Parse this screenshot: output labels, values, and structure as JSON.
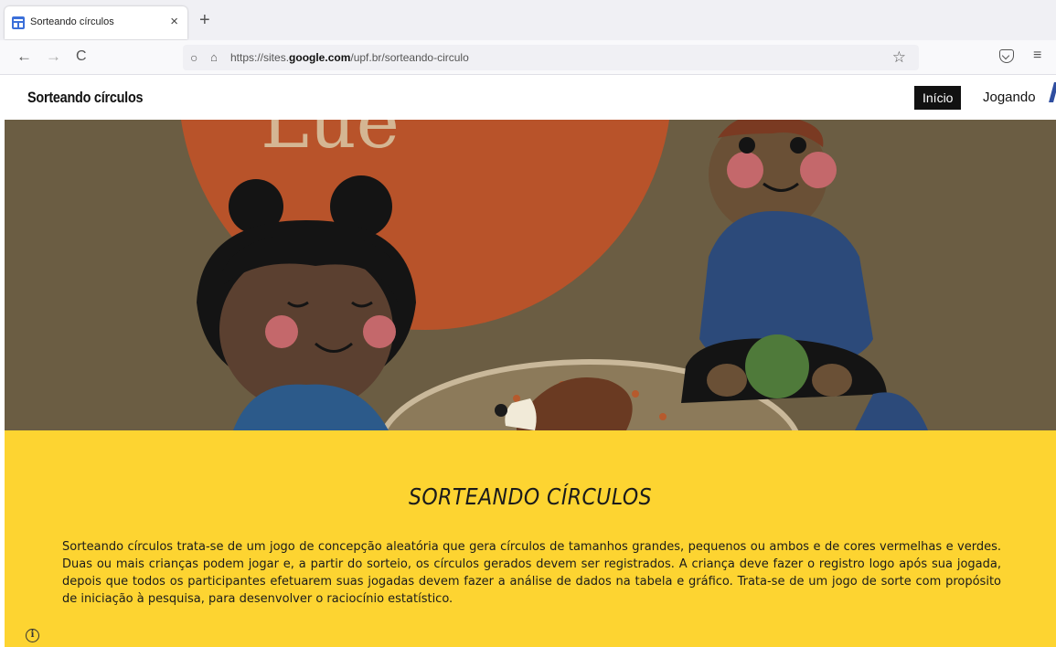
{
  "browser": {
    "tab_title": "Sorteando círculos",
    "tab_close": "×",
    "new_tab": "+",
    "back": "←",
    "forward": "→",
    "reload": "C",
    "url_prefix": "https://sites.",
    "url_domain": "google.com",
    "url_path": "/upf.br/sorteando-circulo",
    "star": "☆",
    "menu": "≡"
  },
  "site": {
    "title": "Sorteando círculos",
    "nav": [
      {
        "label": "Início",
        "active": true
      },
      {
        "label": "Jogando",
        "active": false
      }
    ]
  },
  "hero": {
    "image_text": "Lue"
  },
  "main": {
    "heading": "SORTEANDO CÍRCULOS",
    "paragraph": "Sorteando círculos trata-se de um jogo de concepção aleatória que gera círculos de tamanhos grandes, pequenos ou ambos e de cores vermelhas e verdes. Duas ou mais crianças podem jogar e, a partir do sorteio, os círculos gerados devem ser registrados. A criança deve fazer o registro logo após sua jogada, depois que todos os participantes efetuarem suas jogadas devem fazer a análise de dados na tabela e gráfico. Trata-se de um jogo de sorte com propósito de iniciação à pesquisa, para desenvolver o raciocínio estatístico."
  },
  "info_icon": "i",
  "colors": {
    "hero_bg": "#6b5d43",
    "section_bg": "#fdd431",
    "nav_active_bg": "#111111"
  }
}
